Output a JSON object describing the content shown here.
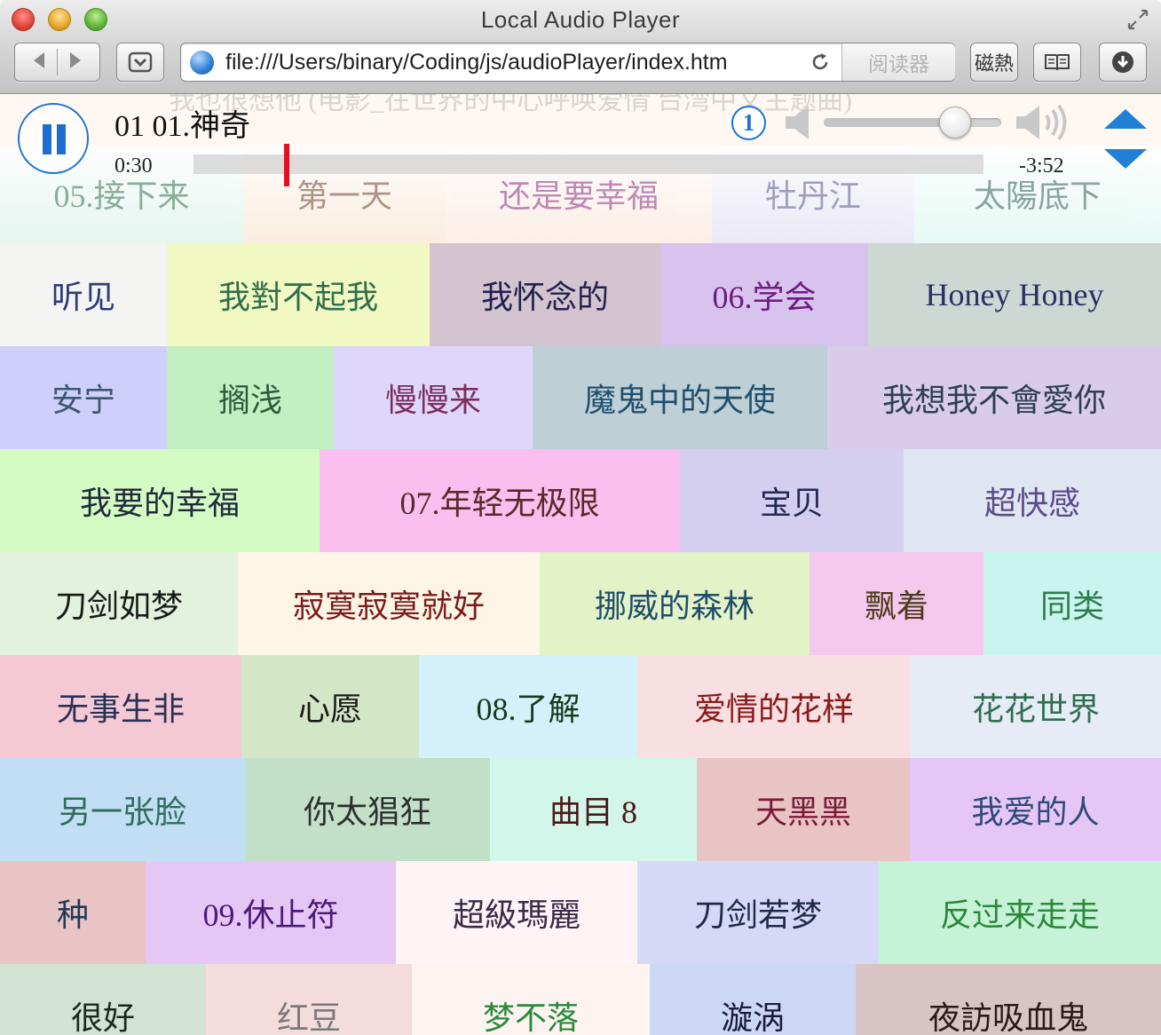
{
  "window": {
    "title": "Local Audio Player"
  },
  "toolbar": {
    "url": "file:///Users/binary/Coding/js/audioPlayer/index.htm",
    "reader_label": "阅读器",
    "extension_label": "磁熱"
  },
  "player": {
    "ghost_title": "我也很想他 (电影_在世界的中心呼唤爱情 台湾中文主题曲)",
    "track_title": "01 01.神奇",
    "elapsed": "0:30",
    "remaining": "-3:52",
    "progress_percent": 11.5,
    "volume_percent": 74,
    "repeat_badge": "1",
    "accent_color": "#1e73d2",
    "playhead_color": "#e3101b"
  },
  "rows": [
    [
      {
        "label": "05.接下来",
        "bg": "#cfeee3",
        "fg": "#2a6b48",
        "fade": true
      },
      {
        "label": "第一天",
        "bg": "#f7dfc4",
        "fg": "#6e3b22",
        "fade": true
      },
      {
        "label": "还是要幸福",
        "bg": "#f8e1d2",
        "fg": "#8a2a78",
        "fade": true
      },
      {
        "label": "牡丹江",
        "bg": "#d9d6ee",
        "fg": "#4f4f8a",
        "fade": true
      },
      {
        "label": "太陽底下",
        "bg": "#d4f5ec",
        "fg": "#2c5b53",
        "fade": true
      }
    ],
    [
      {
        "label": "听见",
        "bg": "#f4f5f3",
        "fg": "#2f3b78"
      },
      {
        "label": "我對不起我",
        "bg": "#f1f8c1",
        "fg": "#2f6e4d"
      },
      {
        "label": "我怀念的",
        "bg": "#d4c4cf",
        "fg": "#23224f"
      },
      {
        "label": "06.学会",
        "bg": "#d8c2ee",
        "fg": "#6c1d7e"
      },
      {
        "label": "Honey Honey",
        "bg": "#cdd8d2",
        "fg": "#2b2f66"
      }
    ],
    [
      {
        "label": "安宁",
        "bg": "#cfcffb",
        "fg": "#3b5871"
      },
      {
        "label": "搁浅",
        "bg": "#c2f0c2",
        "fg": "#2f5a3c"
      },
      {
        "label": "慢慢来",
        "bg": "#dfd6fc",
        "fg": "#7b2e5c"
      },
      {
        "label": "魔鬼中的天使",
        "bg": "#bfcfd6",
        "fg": "#1f4f6e"
      },
      {
        "label": "我想我不會愛你",
        "bg": "#d9cceb",
        "fg": "#2f3f55"
      }
    ],
    [
      {
        "label": "我要的幸福",
        "bg": "#d5fbc5",
        "fg": "#1f2a3b"
      },
      {
        "label": "07.年轻无极限",
        "bg": "#fabfee",
        "fg": "#5a2a2a"
      },
      {
        "label": "宝贝",
        "bg": "#d4cfef",
        "fg": "#232a55"
      },
      {
        "label": "超快感",
        "bg": "#dfe6f2",
        "fg": "#5c4a8a"
      }
    ],
    [
      {
        "label": "刀剑如梦",
        "bg": "#e2f2dd",
        "fg": "#1a1a1a"
      },
      {
        "label": "寂寞寂寞就好",
        "bg": "#fdf6e6",
        "fg": "#7a1c1c"
      },
      {
        "label": "挪威的森林",
        "bg": "#e3f3c7",
        "fg": "#1f4e6a"
      },
      {
        "label": "飘着",
        "bg": "#f5c9ef",
        "fg": "#4e3a1a"
      },
      {
        "label": "同类",
        "bg": "#c9f5ee",
        "fg": "#2e7d4e"
      }
    ],
    [
      {
        "label": "无事生非",
        "bg": "#f5c9d3",
        "fg": "#2a3158"
      },
      {
        "label": "心愿",
        "bg": "#d3e6c5",
        "fg": "#1a1a1a"
      },
      {
        "label": "08.了解",
        "bg": "#d3f0fb",
        "fg": "#1a3a1a"
      },
      {
        "label": "爱情的花样",
        "bg": "#f7dfe2",
        "fg": "#8a1a1a"
      },
      {
        "label": "花花世界",
        "bg": "#e6ebf6",
        "fg": "#2f6e4f"
      }
    ],
    [
      {
        "label": "另一张脸",
        "bg": "#c2def5",
        "fg": "#2f6e5a"
      },
      {
        "label": "你太猖狂",
        "bg": "#c2e0c8",
        "fg": "#2f2f2f"
      },
      {
        "label": "曲目 8",
        "bg": "#d2f7ea",
        "fg": "#4a1a1a"
      },
      {
        "label": "天黑黑",
        "bg": "#e8c4c4",
        "fg": "#7a1a3a"
      },
      {
        "label": "我爱的人",
        "bg": "#e5c6f7",
        "fg": "#2f4a7a"
      }
    ],
    [
      {
        "label": "种",
        "bg": "#e9c4c4",
        "fg": "#1f3a5a"
      },
      {
        "label": "09.休止符",
        "bg": "#e6c6f5",
        "fg": "#4a1a7a"
      },
      {
        "label": "超級瑪麗",
        "bg": "#fdf5f5",
        "fg": "#3a2a4a"
      },
      {
        "label": "刀剑若梦",
        "bg": "#d6d9f5",
        "fg": "#1f2a4a"
      },
      {
        "label": "反过来走走",
        "bg": "#c6f3d8",
        "fg": "#2a8a3a"
      }
    ],
    [
      {
        "label": "很好",
        "bg": "#d3e3d3",
        "fg": "#1a2a1a"
      },
      {
        "label": "红豆",
        "bg": "#f5dcdc",
        "fg": "#7a7a7a"
      },
      {
        "label": "梦不落",
        "bg": "#fdf3f0",
        "fg": "#2a8a3a"
      },
      {
        "label": "漩涡",
        "bg": "#ccd7f5",
        "fg": "#1a1a3a"
      },
      {
        "label": "夜訪吸血鬼",
        "bg": "#d9c4c4",
        "fg": "#2a1a1a"
      }
    ]
  ]
}
